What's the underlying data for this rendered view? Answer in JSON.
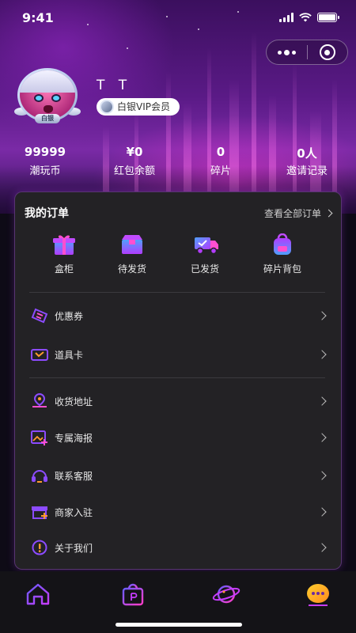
{
  "status_bar": {
    "time": "9:41"
  },
  "profile": {
    "avatar_badge": "白银",
    "username": "T T",
    "vip_label": "白银VIP会员"
  },
  "stats": [
    {
      "value": "99999",
      "label": "潮玩币"
    },
    {
      "value": "¥0",
      "label": "红包余额"
    },
    {
      "value": "0",
      "label": "碎片"
    },
    {
      "value": "0人",
      "label": "邀请记录"
    }
  ],
  "orders": {
    "title": "我的订单",
    "view_all": "查看全部订单",
    "items": [
      {
        "label": "盒柜",
        "icon": "gift-box-icon"
      },
      {
        "label": "待发货",
        "icon": "package-box-icon"
      },
      {
        "label": "已发货",
        "icon": "delivery-truck-icon"
      },
      {
        "label": "碎片背包",
        "icon": "backpack-icon"
      }
    ]
  },
  "menu_group_1": [
    {
      "label": "优惠券",
      "icon": "coupon-icon"
    },
    {
      "label": "道具卡",
      "icon": "ticket-card-icon"
    }
  ],
  "menu_group_2": [
    {
      "label": "收货地址",
      "icon": "location-pin-icon"
    },
    {
      "label": "专属海报",
      "icon": "poster-image-icon"
    },
    {
      "label": "联系客服",
      "icon": "headset-icon"
    },
    {
      "label": "商家入驻",
      "icon": "store-icon"
    },
    {
      "label": "关于我们",
      "icon": "info-alert-icon"
    }
  ],
  "tabs": [
    {
      "name": "home",
      "icon": "home-icon"
    },
    {
      "name": "shop",
      "icon": "shopping-bag-icon"
    },
    {
      "name": "discover",
      "icon": "planet-icon"
    },
    {
      "name": "me",
      "icon": "chat-face-icon",
      "active": true
    }
  ],
  "colors": {
    "accent_purple": "#a03cff",
    "accent_pink": "#ff3cc8",
    "card_bg": "#232225",
    "page_bg": "#0e0b16"
  }
}
